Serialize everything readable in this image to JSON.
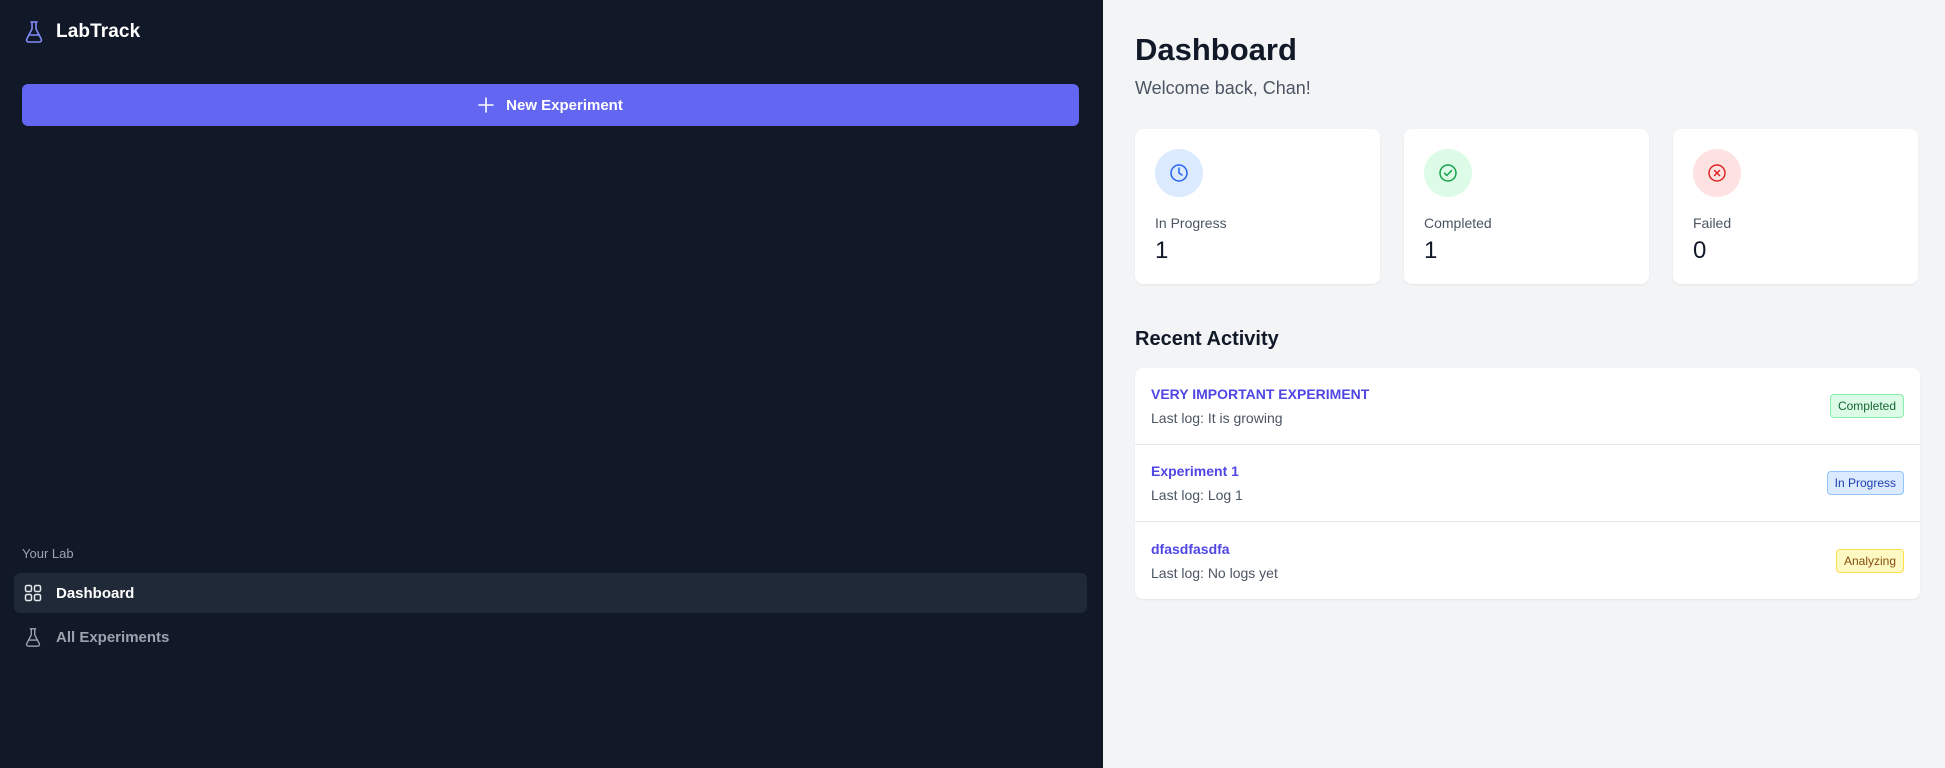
{
  "app": {
    "name": "LabTrack"
  },
  "sidebar": {
    "new_button_label": "New Experiment",
    "section_label": "Your Lab",
    "items": [
      {
        "label": "Dashboard",
        "icon": "grid-icon",
        "active": true
      },
      {
        "label": "All Experiments",
        "icon": "flask-icon",
        "active": false
      }
    ]
  },
  "main": {
    "title": "Dashboard",
    "welcome": "Welcome back, Chan!",
    "stats": [
      {
        "label": "In Progress",
        "value": "1",
        "icon": "clock-icon"
      },
      {
        "label": "Completed",
        "value": "1",
        "icon": "check-circle-icon"
      },
      {
        "label": "Failed",
        "value": "0",
        "icon": "x-circle-icon"
      }
    ],
    "recent_title": "Recent Activity",
    "activity": [
      {
        "name": "VERY IMPORTANT EXPERIMENT",
        "log": "Last log: It is growing",
        "status": "Completed"
      },
      {
        "name": "Experiment 1",
        "log": "Last log: Log 1",
        "status": "In Progress"
      },
      {
        "name": "dfasdfasdfa",
        "log": "Last log: No logs yet",
        "status": "Analyzing"
      }
    ]
  },
  "colors": {
    "sidebar_bg": "#111827",
    "accent": "#6366f1",
    "link": "#4f46e5",
    "completed": "#166534",
    "in_progress": "#1e40af",
    "analyzing": "#854d0e",
    "failed": "#dc2626"
  }
}
